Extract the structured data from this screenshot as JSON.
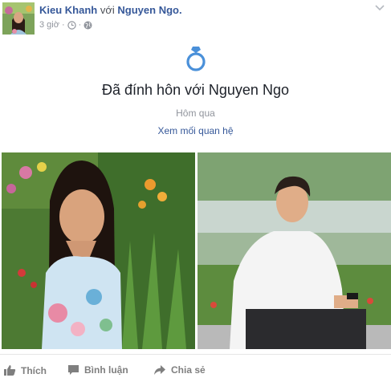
{
  "post": {
    "author": "Kieu Khanh",
    "with_word": "với",
    "tagged": "Nguyen Ngo.",
    "time": "3 giờ",
    "time_sep": "·"
  },
  "event": {
    "icon": "ring-icon",
    "title": "Đã đính hôn với Nguyen Ngo",
    "date": "Hôm qua",
    "link": "Xem mối quan hệ"
  },
  "actions": {
    "like": "Thích",
    "comment": "Bình luận",
    "share": "Chia sẻ"
  },
  "colors": {
    "link_blue": "#365899",
    "meta_gray": "#90949c",
    "action_gray": "#7f7f7f"
  }
}
